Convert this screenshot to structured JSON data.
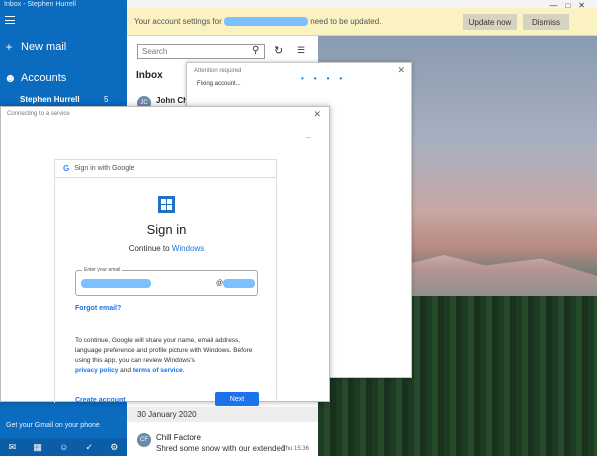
{
  "window": {
    "title": "Inbox - Stephen Hurrell"
  },
  "sidebar": {
    "new_mail": "New mail",
    "accounts": "Accounts",
    "account_name": "Stephen Hurrell",
    "account_count": "5",
    "gmail_link": "Get your Gmail on your phone"
  },
  "notification": {
    "text_before": "Your account settings for",
    "text_after": "need to be updated.",
    "update_label": "Update now",
    "dismiss_label": "Dismiss"
  },
  "mail_list": {
    "search_placeholder": "Search",
    "inbox_label": "Inbox",
    "first_sender": "John Ch",
    "first_initials": "JC",
    "date_header": "30 January 2020",
    "message": {
      "initials": "CF",
      "sender": "Chill Factore",
      "subject": "Shred some snow with our extended",
      "time": "Thu 15:36"
    }
  },
  "attention_dialog": {
    "title": "Attention required",
    "message": "Fixing account..."
  },
  "connecting_dialog": {
    "title": "Connecting to a service",
    "google_header": "Sign in with Google",
    "signin_title": "Sign in",
    "continue_prefix": "Continue to",
    "continue_brand": "Windows",
    "email_label": "Enter your email",
    "email_at": "@",
    "forgot_email": "Forgot email?",
    "info_text": "To continue, Google will share your name, email address, language preference and profile picture with Windows. Before using this app, you can review Windows's",
    "privacy_link": "privacy policy",
    "and_word": "and",
    "terms_link": "terms of service",
    "create_account": "Create account",
    "next_label": "Next"
  },
  "colors": {
    "accent": "#0b6bbf",
    "google_blue": "#1a73e8",
    "notification_bg": "#fbf2c2"
  }
}
